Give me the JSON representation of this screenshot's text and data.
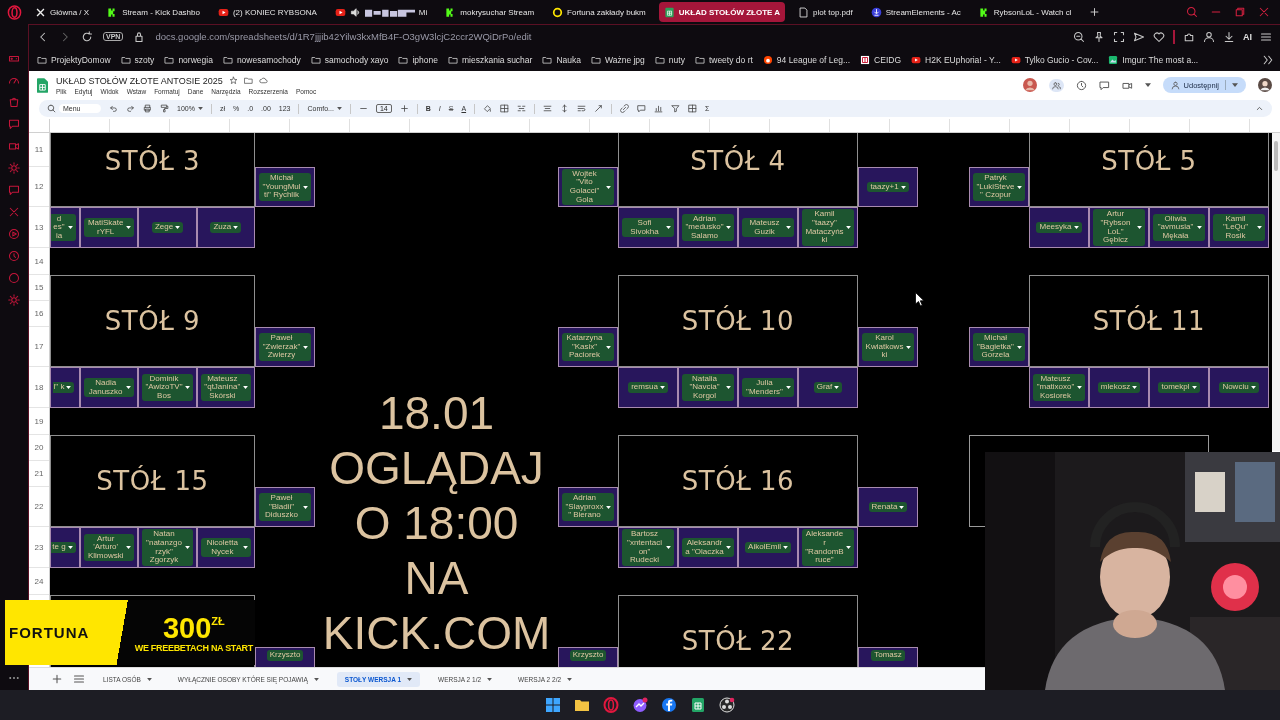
{
  "browser_tabs": [
    {
      "title": "Główna / X",
      "selected": false,
      "audio": false,
      "redacted": false
    },
    {
      "title": "Stream - Kick Dashbo",
      "selected": false,
      "audio": false,
      "redacted": false
    },
    {
      "title": "(2) KONIEC RYBSONA",
      "selected": false,
      "audio": false,
      "redacted": false
    },
    {
      "title": "Mi",
      "selected": false,
      "audio": true,
      "redacted": true
    },
    {
      "title": "mokrysuchar Stream",
      "selected": false,
      "audio": false,
      "redacted": false
    },
    {
      "title": "Fortuna zakłady bukm",
      "selected": false,
      "audio": false,
      "redacted": false
    },
    {
      "title": "UKŁAD STOŁÓW ZŁOTE A",
      "selected": true,
      "audio": false,
      "redacted": false
    },
    {
      "title": "plot top.pdf",
      "selected": false,
      "audio": false,
      "redacted": false
    },
    {
      "title": "StreamElements - Ac",
      "selected": false,
      "audio": false,
      "redacted": false
    },
    {
      "title": "RybsonLoL - Watch cl",
      "selected": false,
      "audio": false,
      "redacted": false
    }
  ],
  "address_bar": {
    "vpn": "VPN",
    "url": "docs.google.com/spreadsheets/d/1R7jjjib42Yilw3kxMfB4F-O3gW3lcjC2ccr2WQiDrPo/edit",
    "ai": "AI"
  },
  "bookmarks": [
    {
      "label": "ProjektyDomow",
      "kind": "folder"
    },
    {
      "label": "szoty",
      "kind": "folder"
    },
    {
      "label": "norwegia",
      "kind": "folder"
    },
    {
      "label": "nowesamochody",
      "kind": "folder"
    },
    {
      "label": "samochody xayo",
      "kind": "folder"
    },
    {
      "label": "iphone",
      "kind": "folder"
    },
    {
      "label": "mieszkania suchar",
      "kind": "folder"
    },
    {
      "label": "Nauka",
      "kind": "folder"
    },
    {
      "label": "Ważne jpg",
      "kind": "folder"
    },
    {
      "label": "nuty",
      "kind": "folder"
    },
    {
      "label": "tweety do rt",
      "kind": "folder"
    },
    {
      "label": "94 League of Leg...",
      "kind": "site"
    },
    {
      "label": "CEIDG",
      "kind": "site"
    },
    {
      "label": "H2K EUphoria! - Y...",
      "kind": "site"
    },
    {
      "label": "Tylko Gucio - Cov...",
      "kind": "site"
    },
    {
      "label": "Imgur: The most a...",
      "kind": "site"
    }
  ],
  "sheets": {
    "title": "UKŁAD STOŁÓW ZŁOTE ANTOSIE 2025",
    "menus": [
      "Plik",
      "Edytuj",
      "Widok",
      "Wstaw",
      "Formatuj",
      "Dane",
      "Narzędzia",
      "Rozszerzenia",
      "Pomoc"
    ],
    "share_label": "Udostępnij",
    "toolbar": {
      "search_placeholder": "Menu",
      "zoom": "100%",
      "currency": "zł",
      "percent": "%",
      "decrease_decimals": ".0",
      "increase_decimals": ".00",
      "number_format": "123",
      "font": "Comfo...",
      "font_size": "14",
      "bold": "B",
      "italic": "I",
      "strikethrough": "S",
      "text_color": "A",
      "sum": "Σ"
    },
    "row_numbers": [
      "11",
      "12",
      "13",
      "14",
      "15",
      "16",
      "17",
      "18",
      "19",
      "20",
      "21",
      "22",
      "23",
      "24"
    ],
    "headline": "18.01\nOGLĄDAJ\nO 18:00\nNA\nKICK.COM",
    "table_columns": [
      [
        {
          "title": "STÓŁ 3",
          "right_seat": {
            "name": "Michał \"YoungMulti\" Rychlik",
            "kind": "full"
          },
          "seats": [
            {
              "name": "d es\" ia",
              "kind": "cut"
            },
            {
              "name": "MatiSkaterYFL",
              "kind": "full"
            },
            {
              "name": "Zege",
              "kind": "full"
            },
            {
              "name": "Zuza",
              "kind": "full"
            }
          ]
        },
        {
          "title": "STÓŁ 9",
          "right_seat": {
            "name": "Paweł \"Zwierzak\" Zwierzy",
            "kind": "full"
          },
          "seats": [
            {
              "name": "l\" k",
              "kind": "cut"
            },
            {
              "name": "Nadia Januszko",
              "kind": "full"
            },
            {
              "name": "Dominik \"AwizoTV\" Bos",
              "kind": "full"
            },
            {
              "name": "Mateusz \"qtJanina\" Skórski",
              "kind": "full"
            }
          ]
        },
        {
          "title": "STÓŁ 15",
          "right_seat": {
            "name": "Paweł \"Bladii\" Diduszko",
            "kind": "full"
          },
          "seats": [
            {
              "name": "te g",
              "kind": "cut"
            },
            {
              "name": "Artur 'Arturo' Klimowski",
              "kind": "full"
            },
            {
              "name": "Natan \"natanzgorzyk\" Zgorzyk",
              "kind": "full"
            },
            {
              "name": "Nicoletta Nycek",
              "kind": "full"
            }
          ]
        },
        {
          "right_seat": {
            "name": "Krzyszto",
            "kind": "clipped"
          }
        }
      ],
      [
        {
          "title": "STÓŁ 4",
          "left_seat": {
            "name": "Wojtek \"Vito Golacci\" Gola",
            "kind": "full"
          },
          "right_seat": {
            "name": "taazy+1",
            "kind": "full"
          },
          "seats": [
            {
              "name": "Sofi Sivokha",
              "kind": "full"
            },
            {
              "name": "Adrian \"medusko\" Salamo",
              "kind": "full"
            },
            {
              "name": "Mateusz Guzik",
              "kind": "full"
            },
            {
              "name": "Kamil \"taazy\" Mataczyński",
              "kind": "full"
            }
          ]
        },
        {
          "title": "STÓŁ 10",
          "left_seat": {
            "name": "Katarzyna \"Kasix\" Paciorek",
            "kind": "full"
          },
          "right_seat": {
            "name": "Karol Kwiatkowski",
            "kind": "full"
          },
          "seats": [
            {
              "name": "remsua",
              "kind": "full"
            },
            {
              "name": "Natalia \"Navcia\" Korgol",
              "kind": "full"
            },
            {
              "name": "Julia \"Menders\"",
              "kind": "full"
            },
            {
              "name": "Graf",
              "kind": "full"
            }
          ]
        },
        {
          "title": "STÓŁ 16",
          "left_seat": {
            "name": "Adrian \"Slayproxx\" Bierano",
            "kind": "full"
          },
          "right_seat": {
            "name": "Renata",
            "kind": "full"
          },
          "seats": [
            {
              "name": "Bartosz \"xntentacion\" Rudecki",
              "kind": "full"
            },
            {
              "name": "Aleksandra \"Olaczka",
              "kind": "full"
            },
            {
              "name": "AikolEmil",
              "kind": "full"
            },
            {
              "name": "Aleksander \"RandomBruce\"",
              "kind": "full"
            }
          ]
        },
        {
          "title": "STÓŁ 22",
          "left_seat": {
            "name": "Krzyszto",
            "kind": "clipped"
          },
          "right_seat": {
            "name": "Tomasz",
            "kind": "clipped"
          }
        }
      ],
      [
        {
          "title": "STÓŁ 5",
          "left_seat": {
            "name": "Patryk \"LukiSteve\" Czopur",
            "kind": "full"
          },
          "seats": [
            {
              "name": "Meesyka",
              "kind": "full"
            },
            {
              "name": "Artur \"Rybson LoL\" Gębicz",
              "kind": "full"
            },
            {
              "name": "Oliwia \"avmusia\" Mękała",
              "kind": "full"
            },
            {
              "name": "Kamil \"LeQu\" Rosik",
              "kind": "full"
            }
          ]
        },
        {
          "title": "STÓŁ 11",
          "left_seat": {
            "name": "Michał \"Bagietka\" Gorzela",
            "kind": "full"
          },
          "seats": [
            {
              "name": "Mateusz \"matixoxo\" Kosiorek",
              "kind": "full"
            },
            {
              "name": "mlekosz",
              "kind": "full"
            },
            {
              "name": "tomekpl",
              "kind": "full"
            },
            {
              "name": "Nowciu",
              "kind": "full"
            }
          ]
        },
        {
          "kind": "box"
        }
      ]
    ],
    "sheet_tabs": [
      {
        "label": "LISTA OSÓB",
        "selected": false
      },
      {
        "label": "WYŁĄCZNIE OSOBY KTÓRE SIĘ POJAWIĄ",
        "selected": false
      },
      {
        "label": "STOŁY WERSJA 1",
        "selected": true
      },
      {
        "label": "WERSJA 2 1/2",
        "selected": false
      },
      {
        "label": "WERSJA 2 2/2",
        "selected": false
      }
    ]
  },
  "ad": {
    "brand": "FORTUNA",
    "amount": "300",
    "currency": "ZŁ",
    "tagline": "WE FREEBETACH NA START"
  }
}
